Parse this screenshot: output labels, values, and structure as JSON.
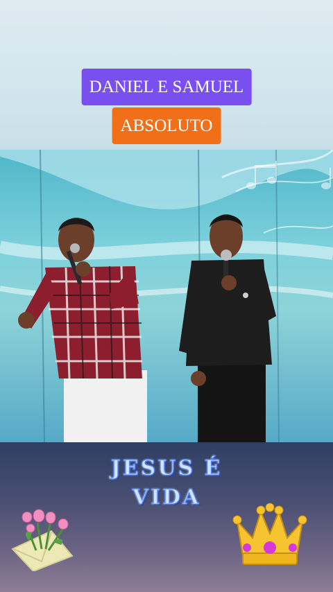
{
  "header": {
    "title_line": "DANIEL E SAMUEL",
    "subtitle_line": "ABSOLUTO"
  },
  "footer": {
    "slogan_line_1": "JESUS É",
    "slogan_line_2": "VIDA",
    "left_icon": "tulips-envelope-icon",
    "right_icon": "crown-icon"
  },
  "colors": {
    "title_bg": "#7a4ff0",
    "subtitle_bg": "#f26f1a",
    "slogan_fill": "#cfe4ff",
    "slogan_stroke": "#4a7cff"
  }
}
